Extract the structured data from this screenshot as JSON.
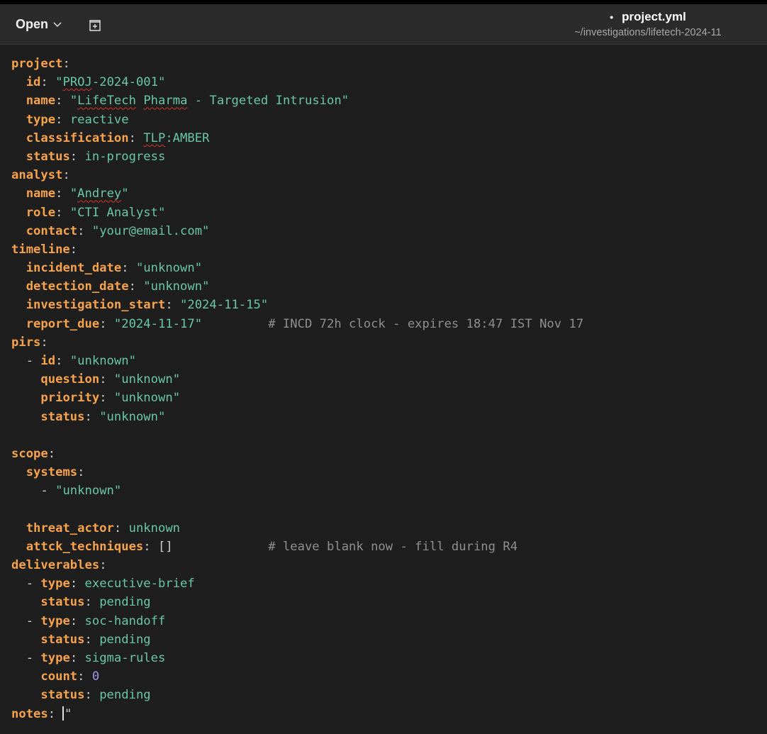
{
  "header": {
    "open_label": "Open",
    "modified_marker": "•",
    "file_name": "project.yml",
    "file_path": "~/investigations/lifetech-2024-11"
  },
  "icons": {
    "open": "chevron-down-icon",
    "new_tab": "new-tab-icon"
  },
  "colors": {
    "key": "#f7a24c",
    "string": "#69c6a8",
    "number": "#a395e8",
    "comment": "#8f8f8f",
    "background": "#1e1e1e"
  },
  "yaml": {
    "project_key": "project",
    "id_key": "id",
    "id_val_pre": "\"",
    "id_val_err": "PROJ",
    "id_val_post": "-2024-001\"",
    "name_key": "name",
    "name_q1": "\"",
    "name_err1": "LifeTech",
    "name_sp": " ",
    "name_err2": "Pharma",
    "name_rest": " - Targeted Intrusion\"",
    "type_key": "type",
    "type_val": "reactive",
    "class_key": "classification",
    "class_err": "TLP",
    "class_rest": ":AMBER",
    "status_key": "status",
    "status_val": "in-progress",
    "analyst_key": "analyst",
    "a_name_key": "name",
    "a_name_q": "\"",
    "a_name_err": "Andrey",
    "a_name_q2": "\"",
    "role_key": "role",
    "role_val": "\"CTI Analyst\"",
    "contact_key": "contact",
    "contact_val": "\"your@email.com\"",
    "timeline_key": "timeline",
    "incident_key": "incident_date",
    "incident_val": "\"unknown\"",
    "detection_key": "detection_date",
    "detection_val": "\"unknown\"",
    "inv_start_key": "investigation_start",
    "inv_start_val": "\"2024-11-15\"",
    "report_key": "report_due",
    "report_val": "\"2024-11-17\"",
    "report_pad": "         ",
    "report_comment": "# INCD 72h clock - expires 18:47 IST Nov 17",
    "pirs_key": "pirs",
    "pir_id_key": "id",
    "pir_id_val": "\"unknown\"",
    "question_key": "question",
    "question_val": "\"unknown\"",
    "priority_key": "priority",
    "priority_val": "\"unknown\"",
    "pir_status_key": "status",
    "pir_status_val": "\"unknown\"",
    "scope_key": "scope",
    "systems_key": "systems",
    "systems_item": "\"unknown\"",
    "threat_key": "threat_actor",
    "threat_val": "unknown",
    "attck_key": "attck_techniques",
    "attck_val": "[]",
    "attck_pad": "             ",
    "attck_comment": "# leave blank now - fill during R4",
    "deliverables_key": "deliverables",
    "d1_type_key": "type",
    "d1_type_val": "executive-brief",
    "d1_status_key": "status",
    "d1_status_val": "pending",
    "d2_type_key": "type",
    "d2_type_val": "soc-handoff",
    "d2_status_key": "status",
    "d2_status_val": "pending",
    "d3_type_key": "type",
    "d3_type_val": "sigma-rules",
    "d3_count_key": "count",
    "d3_count_val": "0",
    "d3_status_key": "status",
    "d3_status_val": "pending",
    "notes_key": "notes",
    "notes_val": "\""
  }
}
